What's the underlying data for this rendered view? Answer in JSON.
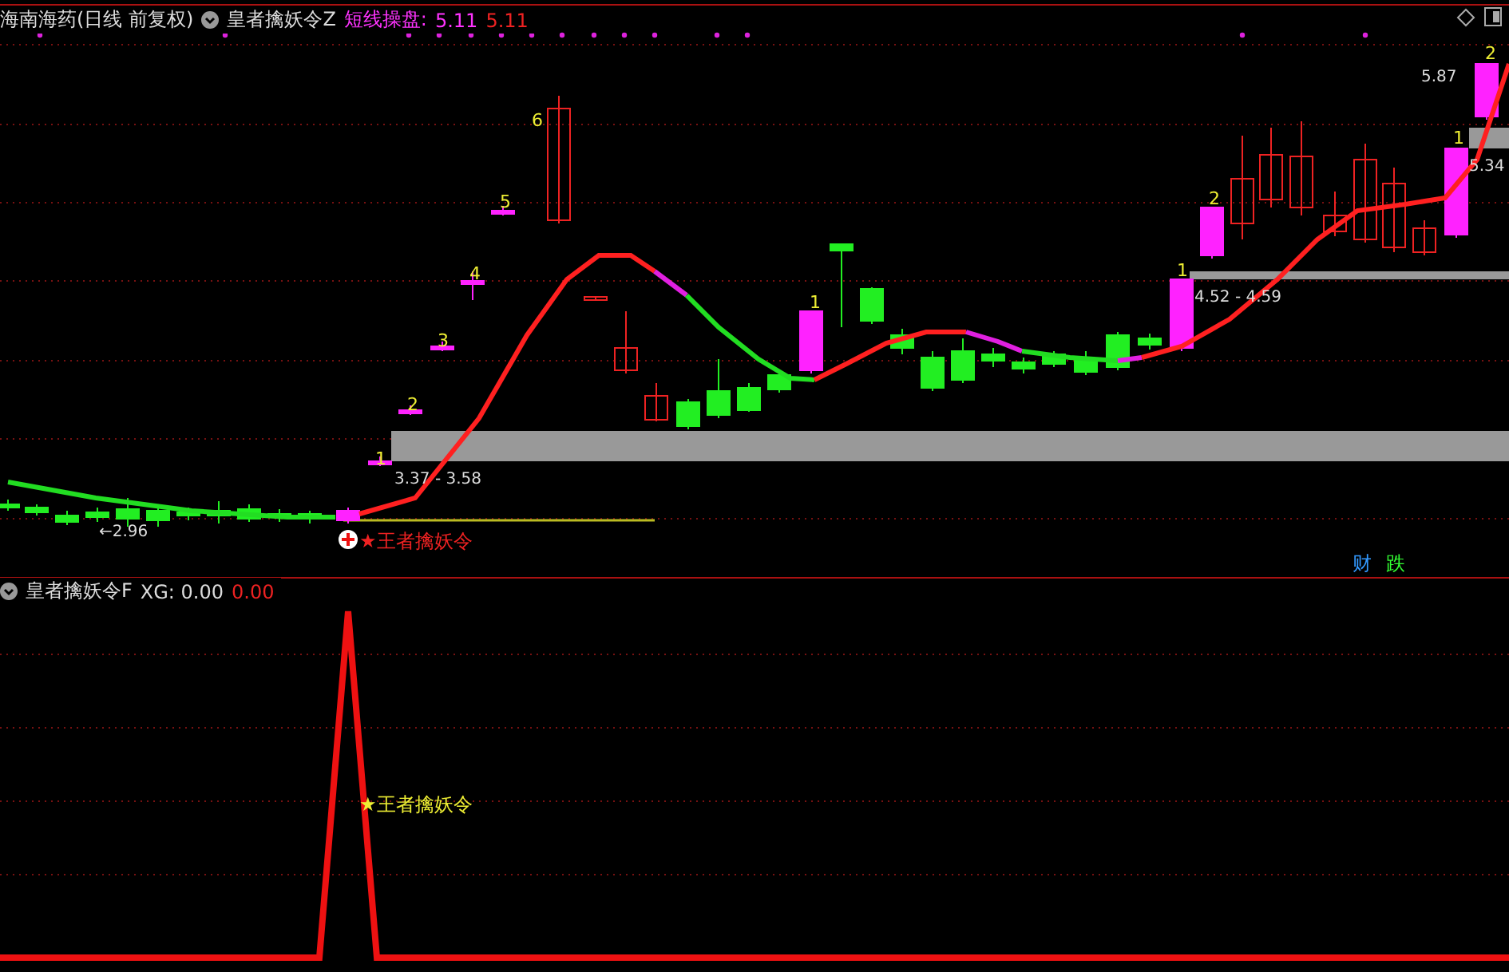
{
  "header": {
    "stock": "海南海药(日线 前复权)",
    "indicator": "皇者擒妖令Z",
    "line_label": "短线操盘:",
    "value_1": "5.11",
    "value_2": "5.11"
  },
  "step_labels": [
    "6",
    "5",
    "4",
    "3",
    "2",
    "1",
    "1",
    "1",
    "2",
    "1",
    "2"
  ],
  "price_labels": [
    "3.37 - 3.58",
    "4.52 - 4.59",
    "5.87",
    "5.34",
    "←2.96"
  ],
  "signal": "★王者擒妖令",
  "markers": [
    {
      "text": "财",
      "color": "#3399ff"
    },
    {
      "text": "跌",
      "color": "#33ff33"
    }
  ],
  "sub_panel": {
    "indicator": "皇者擒妖令F",
    "reading": "XG: 0.00",
    "value": "0.00",
    "signal": "★王者擒妖令"
  }
}
